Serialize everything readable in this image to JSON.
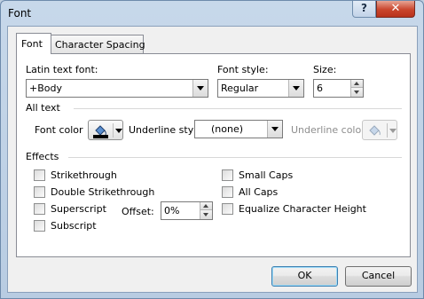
{
  "window": {
    "title": "Font",
    "help_label": "?",
    "close_label": "✕"
  },
  "tabs": [
    {
      "label": "Font",
      "selected": true
    },
    {
      "label": "Character Spacing",
      "selected": false
    }
  ],
  "font": {
    "latin_label": "Latin text font:",
    "latin_value": "+Body",
    "style_label": "Font style:",
    "style_value": "Regular",
    "size_label": "Size:",
    "size_value": "6"
  },
  "all_text": {
    "heading": "All text",
    "font_color_label": "Font color",
    "underline_style_label": "Underline style",
    "underline_style_value": "(none)",
    "underline_color_label": "Underline color"
  },
  "effects": {
    "heading": "Effects",
    "left": [
      "Strikethrough",
      "Double Strikethrough",
      "Superscript",
      "Subscript"
    ],
    "right": [
      "Small Caps",
      "All Caps",
      "Equalize Character Height"
    ],
    "offset_label": "Offset:",
    "offset_value": "0%"
  },
  "buttons": {
    "ok": "OK",
    "cancel": "Cancel"
  },
  "colors": {
    "frame": "#b8cce2",
    "close": "#c9452c",
    "font_color_swatch": "#000000"
  }
}
